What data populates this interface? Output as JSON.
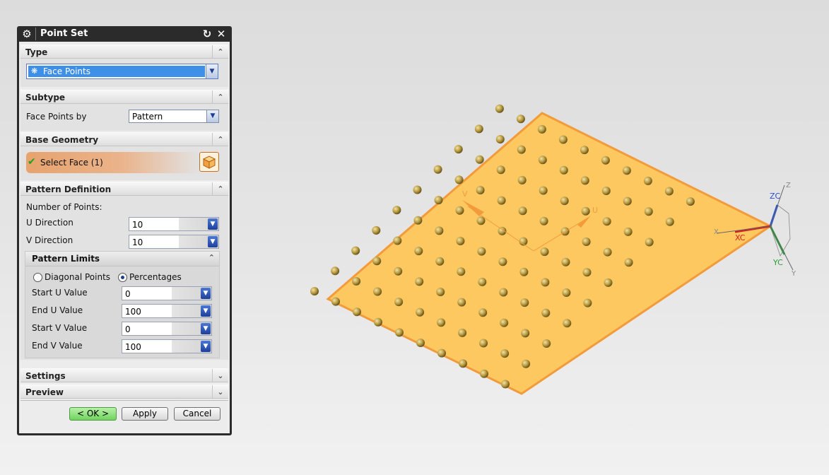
{
  "dialog": {
    "title": "Point Set",
    "buttons": {
      "ok": "< OK >",
      "apply": "Apply",
      "cancel": "Cancel"
    },
    "groups": {
      "type": {
        "label": "Type",
        "value": "Face Points"
      },
      "subtype": {
        "label": "Subtype",
        "field_label": "Face Points by",
        "value": "Pattern"
      },
      "base_geometry": {
        "label": "Base Geometry",
        "select_label": "Select Face (1)"
      },
      "pattern_definition": {
        "label": "Pattern Definition",
        "number_of_points": "Number of Points:",
        "u_label": "U Direction",
        "u_value": "10",
        "v_label": "V Direction",
        "v_value": "10"
      },
      "pattern_limits": {
        "label": "Pattern Limits",
        "option_diagonal": "Diagonal Points",
        "option_percentages": "Percentages",
        "selected_option": "Percentages",
        "start_u_label": "Start U Value",
        "start_u": "0",
        "end_u_label": "End U Value",
        "end_u": "100",
        "start_v_label": "Start V Value",
        "start_v": "0",
        "end_v_label": "End V Value",
        "end_v": "100"
      },
      "settings": {
        "label": "Settings"
      },
      "preview": {
        "label": "Preview"
      }
    }
  },
  "viewport": {
    "u_label": "U",
    "v_label": "V",
    "triad": {
      "xc": "XC",
      "yc": "YC",
      "zc": "ZC",
      "x": "X",
      "y": "Y",
      "z": "Z"
    },
    "colors": {
      "face": "#fec860",
      "edge": "#f39b3a",
      "point": "#b89a3f",
      "x_axis": "#d42020",
      "y_axis": "#2e9a3a",
      "z_axis": "#2350d0"
    },
    "grid_u": 10,
    "grid_v": 10
  }
}
